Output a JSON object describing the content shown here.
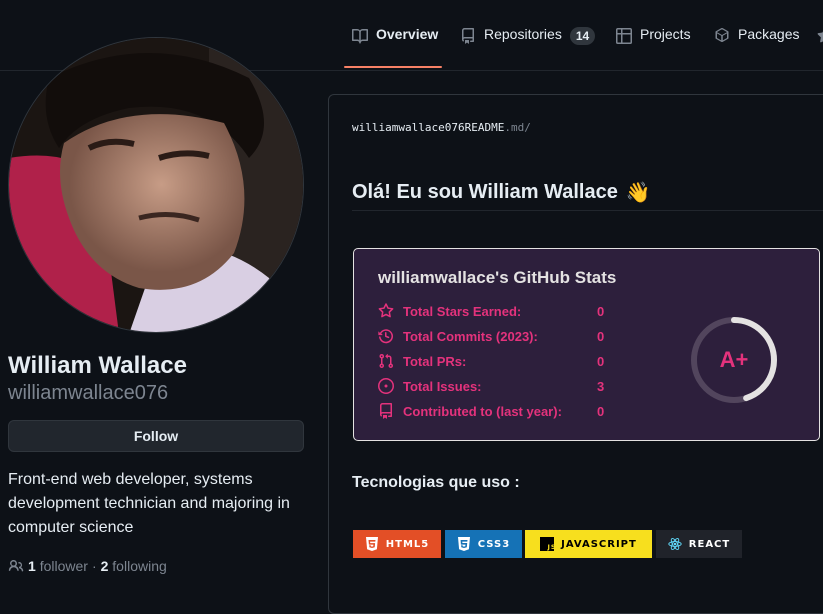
{
  "tabs": [
    {
      "label": "Overview",
      "icon": "book-icon",
      "active": true
    },
    {
      "label": "Repositories",
      "icon": "repo-icon",
      "count": "14"
    },
    {
      "label": "Projects",
      "icon": "table-icon"
    },
    {
      "label": "Packages",
      "icon": "package-icon"
    }
  ],
  "profile": {
    "name": "William Wallace",
    "login": "williamwallace076",
    "follow_label": "Follow",
    "bio": "Front-end web developer, systems development technician and majoring in computer science",
    "followers_count": "1",
    "followers_label": "follower",
    "separator": "·",
    "following_count": "2",
    "following_label": "following"
  },
  "readme": {
    "path_user": "williamwallace076",
    "path_file": "README",
    "path_ext": ".md",
    "path_sep": "/",
    "heading": "Olá! Eu sou William Wallace",
    "heading_emoji": "👋",
    "stats": {
      "title": "williamwallace's GitHub Stats",
      "rows": [
        {
          "label": "Total Stars Earned:",
          "value": "0",
          "icon": "star-icon"
        },
        {
          "label": "Total Commits (2023):",
          "value": "0",
          "icon": "history-icon"
        },
        {
          "label": "Total PRs:",
          "value": "0",
          "icon": "pull-request-icon"
        },
        {
          "label": "Total Issues:",
          "value": "3",
          "icon": "issue-icon"
        },
        {
          "label": "Contributed to (last year):",
          "value": "0",
          "icon": "repo-icon"
        }
      ],
      "grade": "A+",
      "grade_progress": 0.45,
      "colors": {
        "bg": "#2d1f3c",
        "text": "#e4327c",
        "title": "#e4e2e2",
        "ring": "#e4e2e2"
      }
    },
    "tech_title": "Tecnologias que uso :",
    "badges": [
      {
        "label": "HTML5",
        "color": "#e34f26",
        "icon": "html5-icon"
      },
      {
        "label": "CSS3",
        "color": "#1572b6",
        "icon": "css3-icon"
      },
      {
        "label": "JAVASCRIPT",
        "color": "#f7df1e",
        "icon": "javascript-icon"
      },
      {
        "label": "REACT",
        "color": "#20232a",
        "icon": "react-icon"
      }
    ]
  },
  "colors": {
    "background": "#0d1117",
    "tab_underline": "#f78166",
    "muted": "#7d8590"
  }
}
